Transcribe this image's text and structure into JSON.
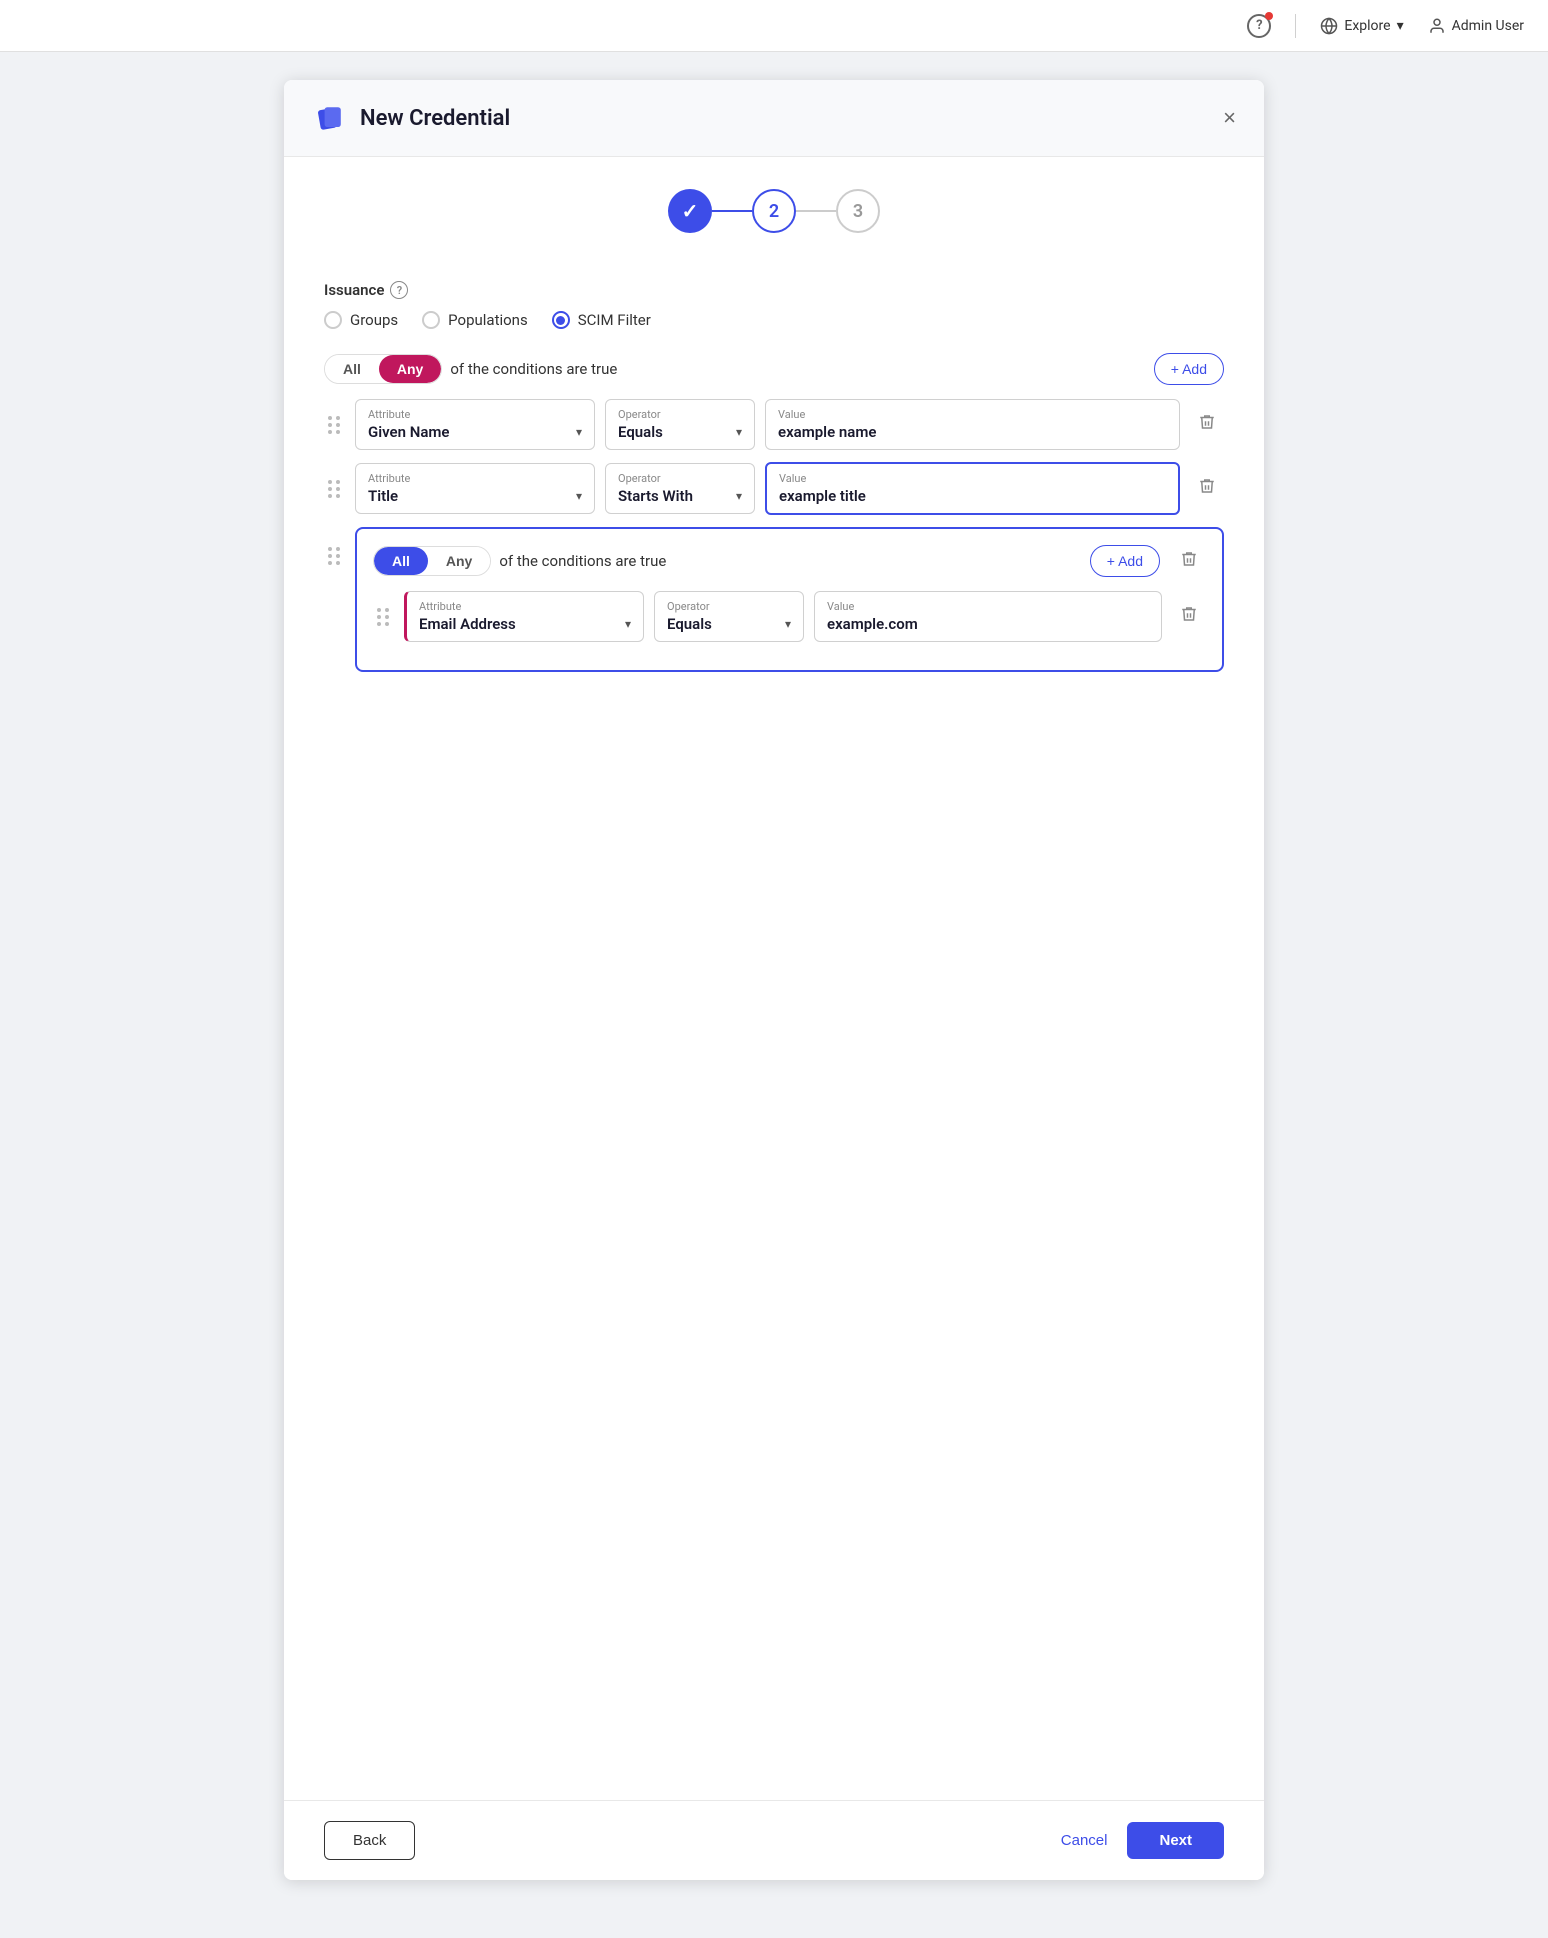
{
  "topnav": {
    "help_label": "?",
    "explore_label": "Explore",
    "user_label": "Admin User"
  },
  "modal": {
    "title": "New Credential",
    "close_label": "×"
  },
  "stepper": {
    "steps": [
      {
        "label": "✓",
        "state": "done"
      },
      {
        "label": "2",
        "state": "active"
      },
      {
        "label": "3",
        "state": "inactive"
      }
    ]
  },
  "issuance": {
    "label": "Issuance",
    "options": [
      {
        "label": "Groups",
        "selected": false
      },
      {
        "label": "Populations",
        "selected": false
      },
      {
        "label": "SCIM Filter",
        "selected": true
      }
    ]
  },
  "outer_filter": {
    "all_label": "All",
    "any_label": "Any",
    "active": "any",
    "conditions_text": "of the conditions are true",
    "add_label": "+ Add",
    "rows": [
      {
        "attribute_label": "Attribute",
        "attribute_value": "Given Name",
        "operator_label": "Operator",
        "operator_value": "Equals",
        "value_label": "Value",
        "value_value": "example name",
        "highlighted": false
      },
      {
        "attribute_label": "Attribute",
        "attribute_value": "Title",
        "operator_label": "Operator",
        "operator_value": "Starts With",
        "value_label": "Value",
        "value_value": "example title",
        "highlighted": true
      }
    ]
  },
  "nested_filter": {
    "all_label": "All",
    "any_label": "Any",
    "active": "all",
    "conditions_text": "of the conditions are true",
    "add_label": "+ Add",
    "rows": [
      {
        "attribute_label": "Attribute",
        "attribute_value": "Email Address",
        "operator_label": "Operator",
        "operator_value": "Equals",
        "value_label": "Value",
        "value_value": "example.com",
        "highlighted": false
      }
    ]
  },
  "footer": {
    "back_label": "Back",
    "cancel_label": "Cancel",
    "next_label": "Next"
  }
}
